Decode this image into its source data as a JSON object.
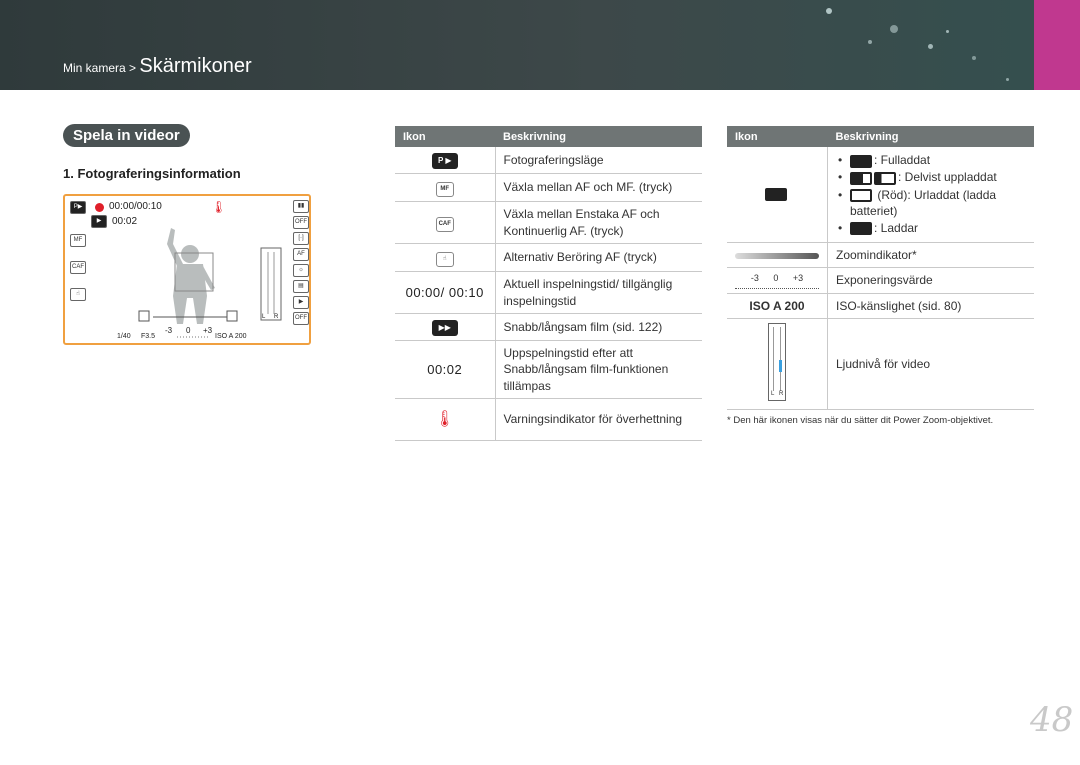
{
  "header": {
    "breadcrumb_small": "Min kamera >",
    "breadcrumb_title": "Skärmikoner",
    "accent_color": "#c0388f",
    "banner_color": "#3d4849"
  },
  "section_title": "Spela in videor",
  "subsection_title": "1. Fotograferingsinformation",
  "lcd": {
    "time_current": "00:00/00:10",
    "time_remaining": "00:02",
    "shutter": "1/40",
    "aperture": "F3.5",
    "ev_min": "-3",
    "ev_mid": "0",
    "ev_max": "+3",
    "iso": "ISO A 200",
    "audio_l": "L",
    "audio_r": "R"
  },
  "table_left": {
    "col_icon": "Ikon",
    "col_desc": "Beskrivning",
    "rows": [
      {
        "icon": "camera-video-p-icon",
        "desc": "Fotograferingsläge"
      },
      {
        "icon": "mf-switch-icon",
        "desc": "Växla mellan AF och MF. (tryck)"
      },
      {
        "icon": "caf-icon",
        "desc": "Växla mellan Enstaka AF och Kontinuerlig AF. (tryck)"
      },
      {
        "icon": "touch-af-icon",
        "desc": "Alternativ Beröring AF (tryck)"
      },
      {
        "icon_text": "00:00/ 00:10",
        "desc": "Aktuell inspelningstid/ tillgänglig inspelningstid"
      },
      {
        "icon": "slow-fast-movie-icon",
        "desc": "Snabb/långsam film (sid. 122)"
      },
      {
        "icon_text": "00:02",
        "desc": "Uppspelningstid efter att Snabb/långsam film-funktionen tillämpas"
      },
      {
        "icon": "overheat-warning-icon",
        "desc": "Varningsindikator för överhettning"
      }
    ]
  },
  "table_right": {
    "col_icon": "Ikon",
    "col_desc": "Beskrivning",
    "battery": {
      "full": ": Fulladdat",
      "partial": ": Delvist uppladdat",
      "empty": "(Röd): Urladdat (ladda batteriet)",
      "charging": ": Laddar"
    },
    "zoom": "Zoomindikator*",
    "exposure_ticks": {
      "min": "-3",
      "mid": "0",
      "max": "+3"
    },
    "exposure": "Exponeringsvärde",
    "iso_icon": "ISO A 200",
    "iso": "ISO-känslighet (sid. 80)",
    "audio_lr": {
      "l": "L",
      "r": "R"
    },
    "audio": "Ljudnivå för video"
  },
  "footnote": "* Den här ikonen visas när du sätter dit Power Zoom-objektivet.",
  "page_number": "48"
}
